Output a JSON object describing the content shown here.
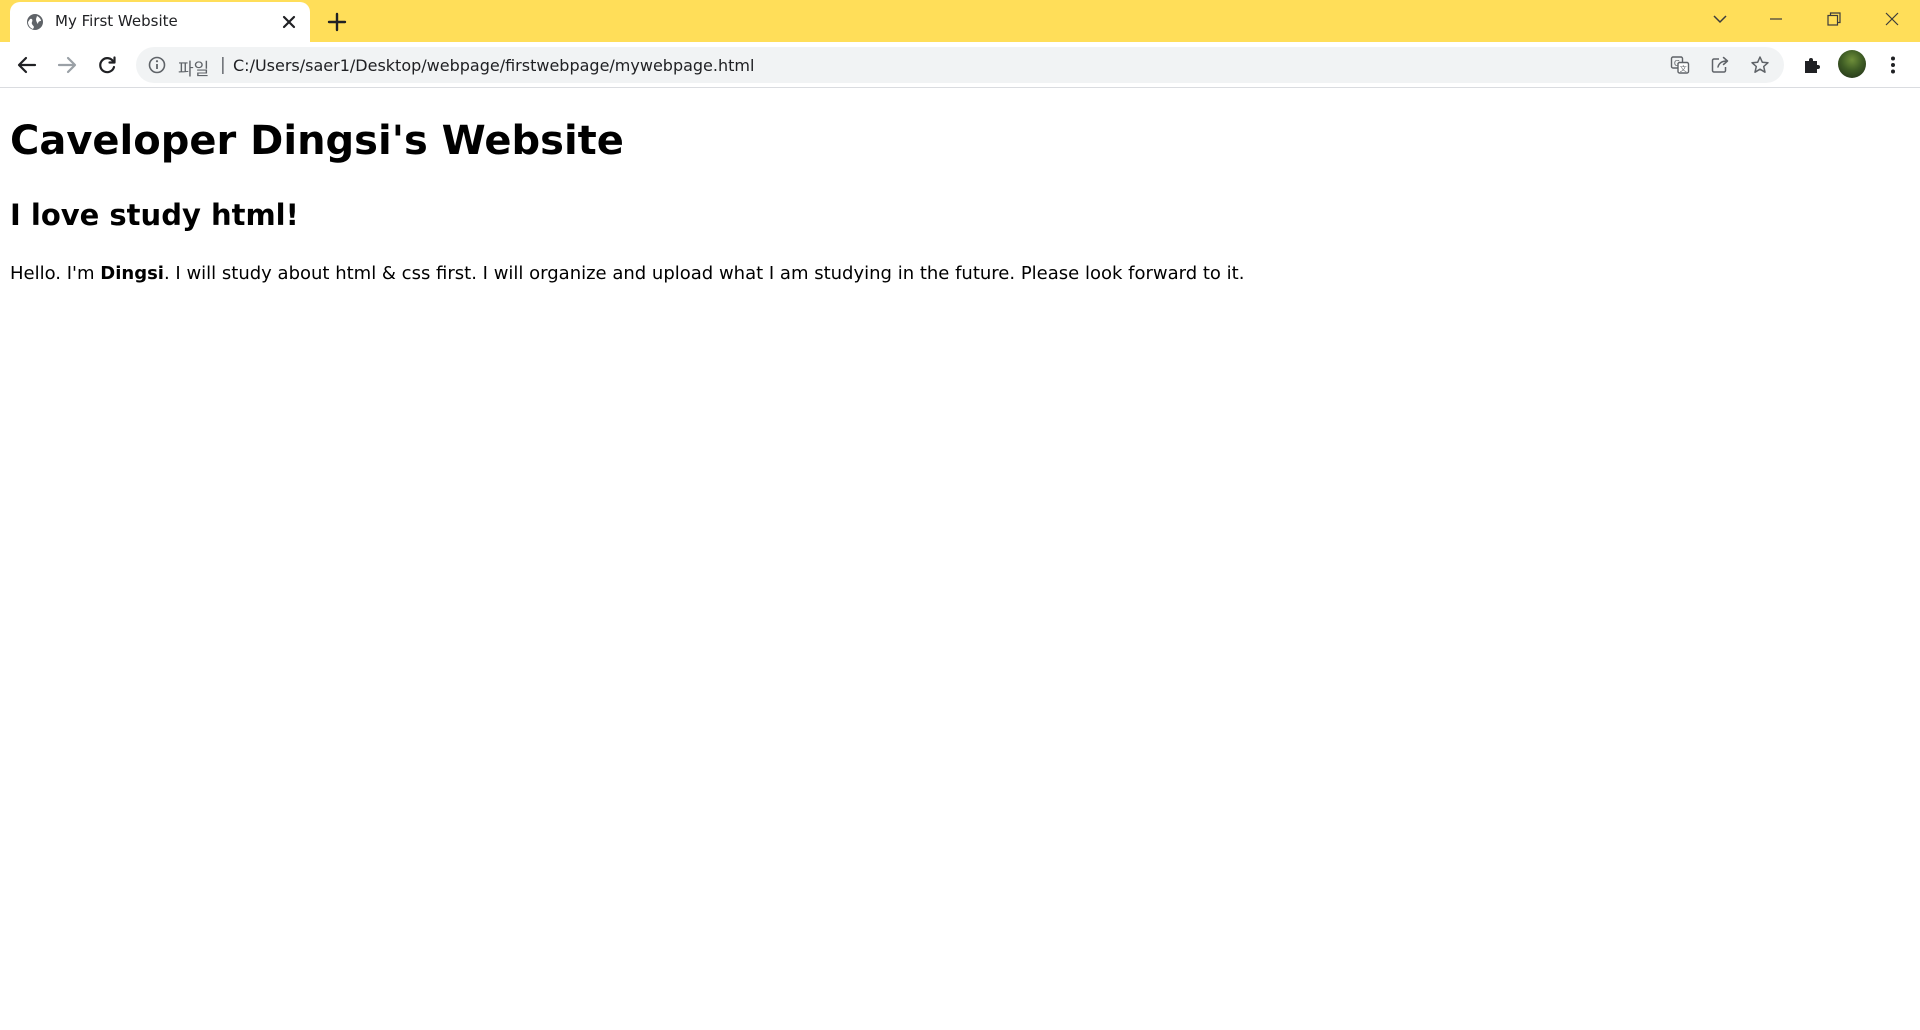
{
  "tab": {
    "title": "My First Website",
    "favicon": "globe-icon",
    "close_icon": "close-icon",
    "new_tab_icon": "plus-icon"
  },
  "window_controls": [
    "tab-search-chevron-icon",
    "minimize-icon",
    "restore-icon",
    "close-window-icon"
  ],
  "address_bar": {
    "info_icon": "info-icon",
    "scheme_label": "파일",
    "separator": "|",
    "url": "C:/Users/saer1/Desktop/webpage/firstwebpage/mywebpage.html",
    "actions": [
      "translate-icon",
      "share-icon",
      "bookmark-star-icon"
    ]
  },
  "toolbar_right": [
    "extensions-puzzle-icon",
    "profile-avatar",
    "menu-kebab-icon"
  ],
  "content": {
    "heading1": "Caveloper Dingsi's Website",
    "heading2": "I love study html!",
    "paragraph": {
      "before": "Hello. I'm ",
      "bold": "Dingsi",
      "after": ". I will study about html & css first. I will organize and upload what I am studying in the future. Please look forward to it."
    }
  },
  "colors": {
    "tabstrip": "#ffde59",
    "omnibox": "#f1f3f4",
    "text": "#000000"
  }
}
